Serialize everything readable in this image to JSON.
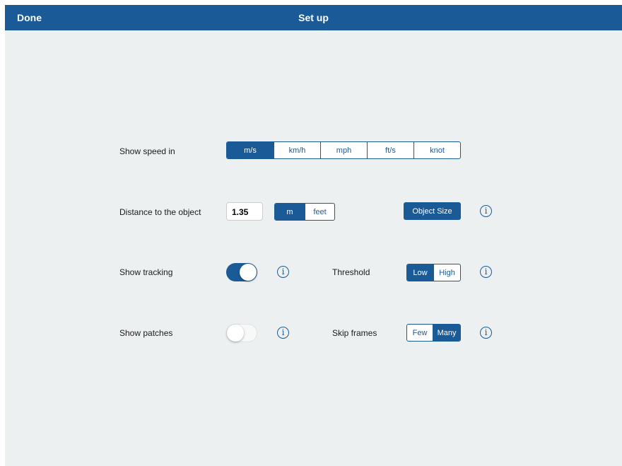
{
  "navbar": {
    "done_label": "Done",
    "title": "Set up"
  },
  "speed": {
    "label": "Show speed in",
    "options": [
      "m/s",
      "km/h",
      "mph",
      "ft/s",
      "knot"
    ],
    "selected": "m/s"
  },
  "distance": {
    "label": "Distance to the object",
    "value": "1.35",
    "units": [
      "m",
      "feet"
    ],
    "selected": "m",
    "object_size_label": "Object Size",
    "info_glyph": "i"
  },
  "tracking": {
    "label": "Show tracking",
    "enabled": true,
    "info_glyph": "i"
  },
  "threshold": {
    "label": "Threshold",
    "options": [
      "Low",
      "High"
    ],
    "selected": "Low",
    "info_glyph": "i"
  },
  "patches": {
    "label": "Show patches",
    "enabled": false,
    "info_glyph": "i"
  },
  "skip_frames": {
    "label": "Skip frames",
    "options": [
      "Few",
      "Many"
    ],
    "selected": "Many",
    "info_glyph": "i"
  },
  "colors": {
    "accent": "#1a5a96",
    "background": "#ecf0f1"
  }
}
